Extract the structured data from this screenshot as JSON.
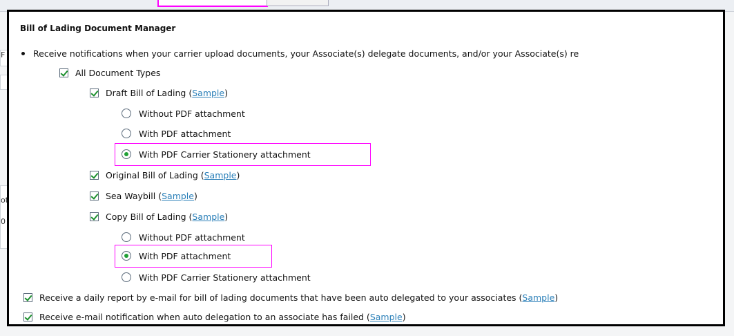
{
  "background": {
    "strip_text_1": "F",
    "strip_text_2": "ot",
    "strip_text_3": "0"
  },
  "section": {
    "title": "Bill of Lading Document Manager",
    "intro": "Receive notifications when your carrier upload documents, your Associate(s) delegate documents, and/or your Associate(s) re"
  },
  "options": {
    "all_types": "All Document Types",
    "draft": {
      "label": "Draft Bill of Lading",
      "sample": "Sample"
    },
    "draft_radios": [
      "Without PDF attachment",
      "With PDF attachment",
      "With PDF Carrier Stationery attachment"
    ],
    "original": {
      "label": "Original Bill of Lading",
      "sample": "Sample"
    },
    "seaway": {
      "label": "Sea Waybill",
      "sample": "Sample"
    },
    "copy": {
      "label": "Copy Bill of Lading",
      "sample": "Sample"
    },
    "copy_radios": [
      "Without PDF attachment",
      "With PDF attachment",
      "With PDF Carrier Stationery attachment"
    ],
    "daily_report": {
      "label": "Receive a daily report by e-mail for bill of lading documents that have been auto delegated to your associates",
      "sample": "Sample"
    },
    "failed_notice": {
      "label": "Receive e-mail notification when auto delegation to an associate has failed",
      "sample": "Sample"
    }
  },
  "state": {
    "draft_selected": "With PDF Carrier Stationery attachment",
    "copy_selected": "With PDF attachment",
    "highlight_color": "#ff00ff",
    "check_color": "#1a8f2c",
    "link_color": "#2a7fb8"
  }
}
